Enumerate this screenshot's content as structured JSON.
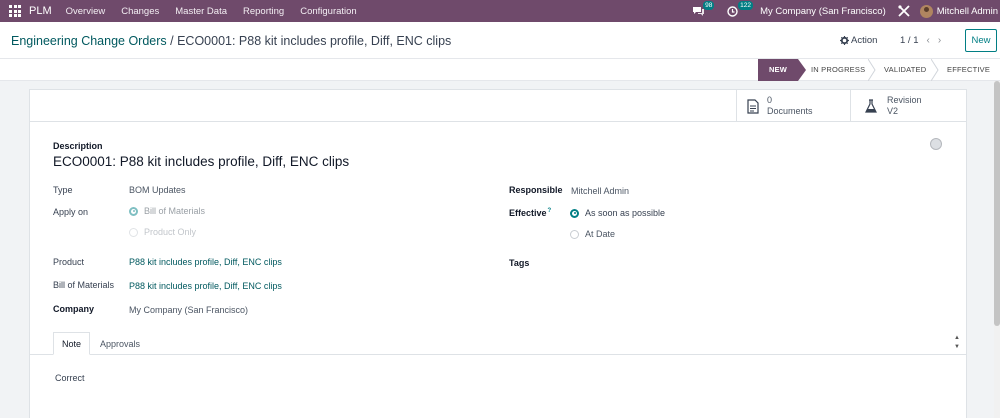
{
  "navbar": {
    "brand": "PLM",
    "menus": [
      "Overview",
      "Changes",
      "Master Data",
      "Reporting",
      "Configuration"
    ],
    "chat_count": "98",
    "activity_count": "122",
    "company": "My Company (San Francisco)",
    "user": "Mitchell Admin"
  },
  "control": {
    "breadcrumb_parent": "Engineering Change Orders",
    "breadcrumb_sep": " / ",
    "breadcrumb_current": "ECO0001: P88 kit includes profile, Diff, ENC clips",
    "action_label": "Action",
    "pager": "1 / 1",
    "new_label": "New"
  },
  "stages": [
    {
      "label": "New",
      "active": true
    },
    {
      "label": "In Progress",
      "active": false
    },
    {
      "label": "Validated",
      "active": false
    },
    {
      "label": "Effective",
      "active": false
    }
  ],
  "smart_buttons": {
    "documents_count": "0",
    "documents_label": "Documents",
    "revision_label": "Revision",
    "revision_value": "V2"
  },
  "form": {
    "description_label": "Description",
    "title": "ECO0001: P88 kit includes profile, Diff, ENC clips",
    "type_label": "Type",
    "type_value": "BOM Updates",
    "apply_on_label": "Apply on",
    "apply_on_options": [
      "Bill of Materials",
      "Product Only"
    ],
    "product_label": "Product",
    "product_value": "P88 kit includes profile, Diff, ENC clips",
    "bom_label": "Bill of Materials",
    "bom_value": "P88 kit includes profile, Diff, ENC clips",
    "company_label": "Company",
    "company_value": "My Company (San Francisco)",
    "responsible_label": "Responsible",
    "responsible_value": "Mitchell Admin",
    "effective_label": "Effective",
    "effective_help": "?",
    "effective_options": [
      "As soon as possible",
      "At Date"
    ],
    "tags_label": "Tags"
  },
  "notebook": {
    "tabs": [
      "Note",
      "Approvals"
    ],
    "note_text": "Correct"
  },
  "colors": {
    "brand": "#6f4a6b",
    "accent": "#017e84",
    "link": "#01595f"
  }
}
